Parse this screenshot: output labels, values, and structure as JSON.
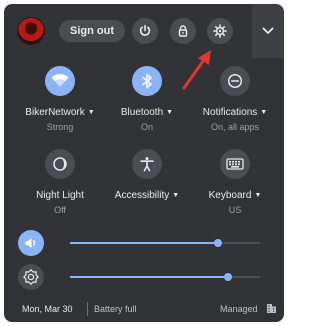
{
  "top": {
    "sign_out_label": "Sign out",
    "icons": [
      "power-icon",
      "lock-icon",
      "gear-icon",
      "chevron-down-icon"
    ]
  },
  "tiles": [
    {
      "name": "BikerNetwork",
      "status": "Strong",
      "icon": "wifi-icon",
      "on": true
    },
    {
      "name": "Bluetooth",
      "status": "On",
      "icon": "bluetooth-icon",
      "on": true
    },
    {
      "name": "Notifications",
      "status": "On, all apps",
      "icon": "do-not-disturb-icon",
      "on": false
    },
    {
      "name": "Night Light",
      "status": "Off",
      "icon": "night-light-icon",
      "on": false
    },
    {
      "name": "Accessibility",
      "status": "",
      "icon": "accessibility-icon",
      "on": false
    },
    {
      "name": "Keyboard",
      "status": "US",
      "icon": "keyboard-icon",
      "on": false
    }
  ],
  "sliders": {
    "volume_level": 0.78,
    "brightness_level": 0.83
  },
  "status_bar": {
    "date": "Mon, Mar 30",
    "battery": "Battery full",
    "managed": "Managed"
  },
  "colors": {
    "panel": "#313336",
    "accent": "#8ab4f8",
    "annotation_arrow": "#e8352b"
  }
}
